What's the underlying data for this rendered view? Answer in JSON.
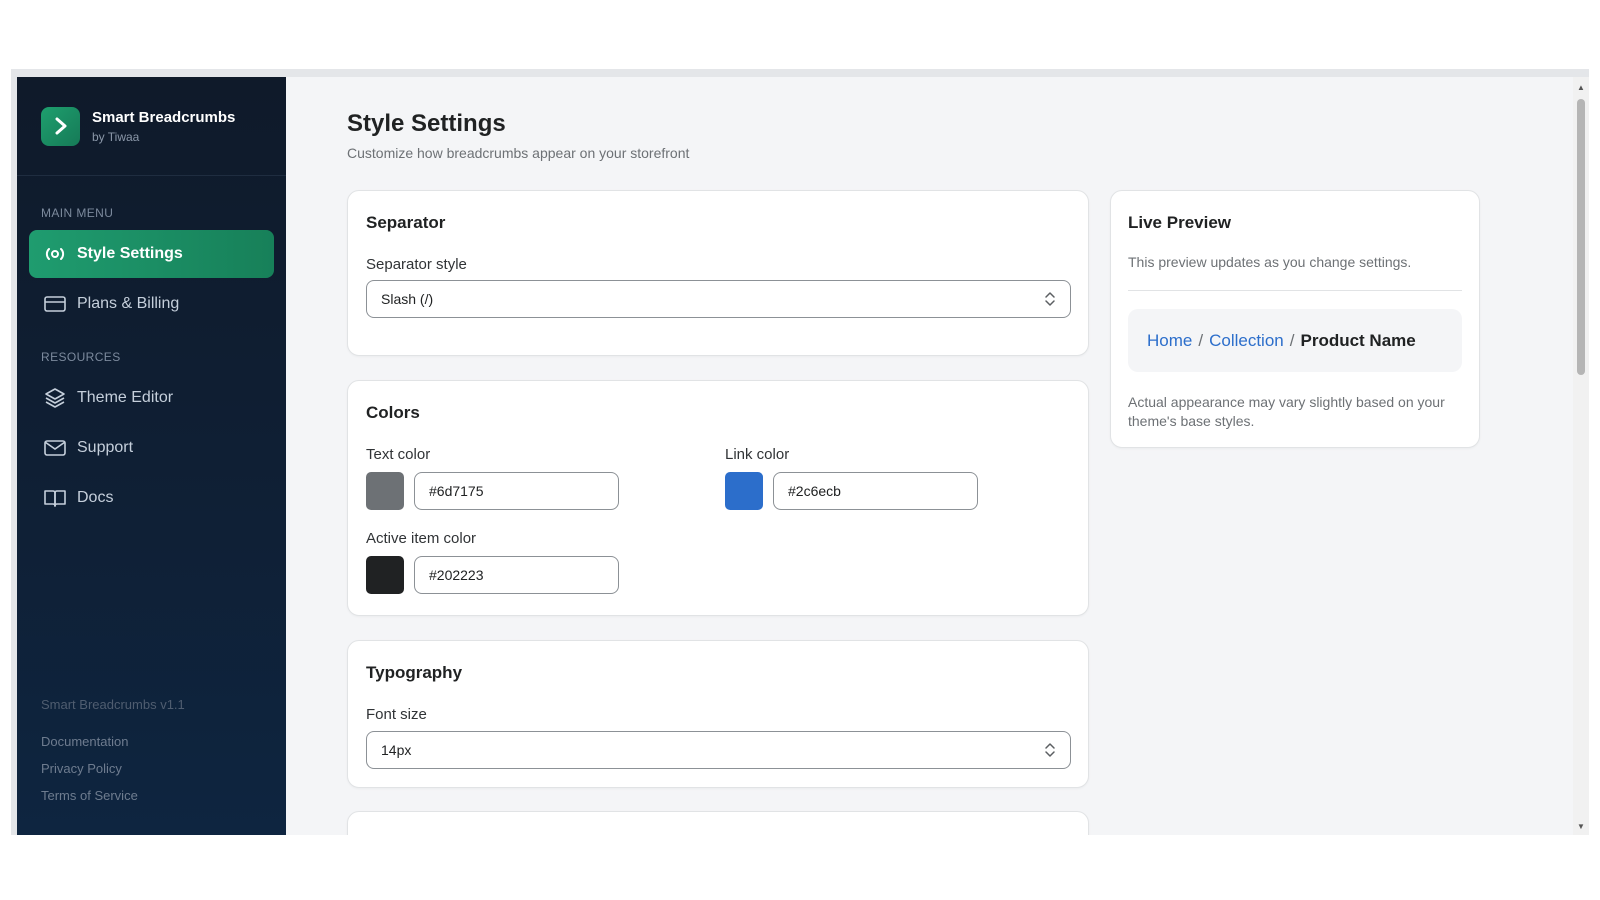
{
  "brand": {
    "title": "Smart Breadcrumbs",
    "subtitle": "by Tiwaa"
  },
  "sidebar": {
    "main_menu_label": "MAIN MENU",
    "resources_label": "RESOURCES",
    "items": [
      {
        "label": "Style Settings",
        "icon": "settings-icon"
      },
      {
        "label": "Plans & Billing",
        "icon": "credit-card-icon"
      },
      {
        "label": "Theme Editor",
        "icon": "layers-icon"
      },
      {
        "label": "Support",
        "icon": "mail-icon"
      },
      {
        "label": "Docs",
        "icon": "book-icon"
      }
    ],
    "footer": {
      "version": "Smart Breadcrumbs v1.1",
      "links": [
        "Documentation",
        "Privacy Policy",
        "Terms of Service"
      ]
    }
  },
  "page": {
    "title": "Style Settings",
    "subtitle": "Customize how breadcrumbs appear on your storefront"
  },
  "separator": {
    "title": "Separator",
    "label": "Separator style",
    "value": "Slash (/)"
  },
  "colors": {
    "title": "Colors",
    "text_color_label": "Text color",
    "text_color_value": "#6d7175",
    "link_color_label": "Link color",
    "link_color_value": "#2c6ecb",
    "active_color_label": "Active item color",
    "active_color_value": "#202223"
  },
  "typography": {
    "title": "Typography",
    "font_size_label": "Font size",
    "font_size_value": "14px"
  },
  "preview": {
    "title": "Live Preview",
    "description": "This preview updates as you change settings.",
    "crumb_home": "Home",
    "sep": "/",
    "crumb_collection": "Collection",
    "crumb_active": "Product Name",
    "note": "Actual appearance may vary slightly based on your theme's base styles."
  },
  "theme": {
    "accent": "#1f9c6f",
    "sidebar_bg": "#0f1a2a"
  }
}
